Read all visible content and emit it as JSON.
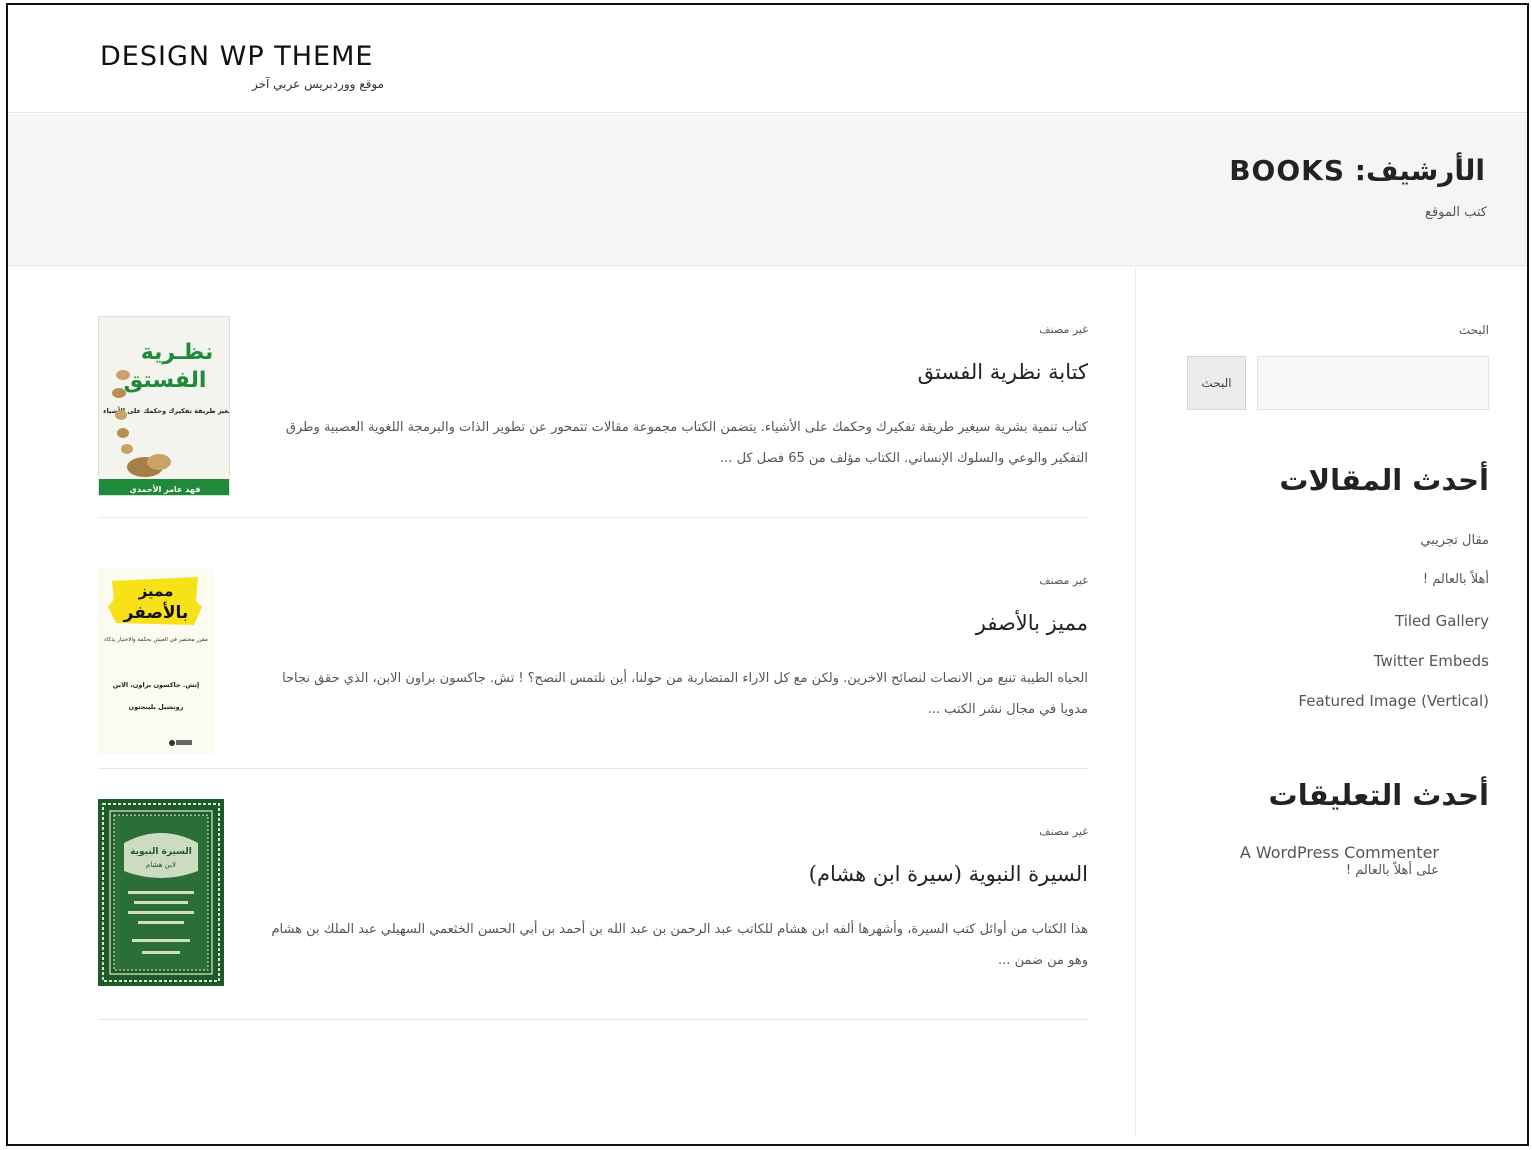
{
  "header": {
    "site_title": "DESIGN WP THEME",
    "site_description": "موقع ووردبريس عربي آخر"
  },
  "archive": {
    "title": "الأرشيف: BOOKS",
    "description": "كتب الموقع"
  },
  "posts": [
    {
      "category": "غير مصنف",
      "title": "كتابة نظرية الفستق",
      "excerpt": "كتاب تنمية بشرية سيغير طريقة تفكيرك وحكمك على الأشياء. يتضمن الكتاب مجموعة مقالات تتمحور عن تطوير الذات والبرمجة اللغوية العصبية وطرق التفكير والوعي والسلوك الإنساني. الكتاب مؤلف من 65 فصل كل ...",
      "cover": {
        "title_line1": "نظـرية",
        "title_line2": "الفستق",
        "subtitle": "كتاب سيغير طريقة تفكيرك وحكمك على الأشياء",
        "author": "فهد عامر الأحمدي"
      }
    },
    {
      "category": "غير مصنف",
      "title": "مميز بالأصفر",
      "excerpt": "الحياه الطيبة تنبع من الانصات لنصائح الاخرين. ولكن مع كل الاراء المتضاربة من حولنا، أين نلتمس النصح؟ ! تش. جاكسون براون الابن، الذي حقق نجاحا مدويا في مجال نشر الكتب ...",
      "cover": {
        "title_line1": "مميز",
        "title_line2": "بالأصفر",
        "subtitle": "مقرر مختصر في العيش بحكمة والاختيار بذكاء",
        "author_line1": "إتش. جاكسون براون، الابن",
        "author_line2": "روتشيل بلينجتون"
      }
    },
    {
      "category": "غير مصنف",
      "title": "السيرة النبوية (سيرة ابن هشام)",
      "excerpt": "هذا الكتاب من أوائل كتب السيرة، وأشهرها ألفه ابن هشام للكاتب عبد الرحمن بن عبد الله بن أحمد بن أبي الحسن الخثعمي السهيلي عبد الملك بن هشام وهو من ضمن ...",
      "cover": {
        "title_line1": "السيرة النبوية",
        "title_line2": "لابن هشام"
      }
    }
  ],
  "sidebar": {
    "search_label": "البحث",
    "search_placeholder": "",
    "search_button": "البحث",
    "recent_posts_title": "أحدث المقالات",
    "recent_posts": [
      "مقال تجريبي",
      "أهلاً بالعالم !",
      "Tiled Gallery",
      "Twitter Embeds",
      "Featured Image (Vertical)"
    ],
    "recent_comments_title": "أحدث التعليقات",
    "comment_author": "A WordPress Commenter",
    "comment_on": "على أهلاً بالعالم !"
  },
  "colors": {
    "band_background": "#f5f5f5",
    "cover1_green": "#1f8a3a",
    "cover2_yellow": "#f7e21a",
    "cover3_green": "#1f5a2a"
  }
}
